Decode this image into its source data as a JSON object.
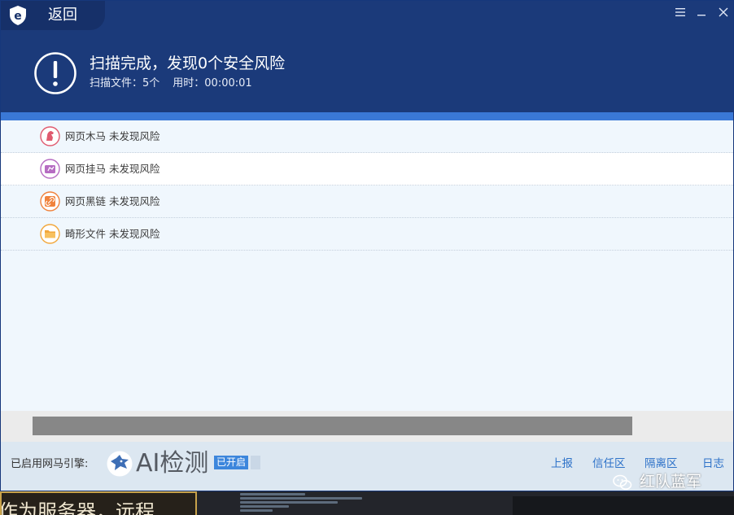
{
  "titlebar": {
    "back_label": "返回",
    "menu_icon": "menu-icon",
    "minimize_icon": "minimize-icon",
    "close_icon": "close-icon"
  },
  "scan_summary": {
    "title": "扫描完成，发现0个安全风险",
    "files_text": "扫描文件：5个",
    "time_text": "用时：00:00:01",
    "icon": "alert-exclamation-icon"
  },
  "results": [
    {
      "label": "网页木马 未发现风险",
      "icon": "webshell-horse-icon",
      "color": "#e05a6f",
      "selected": false
    },
    {
      "label": "网页挂马 未发现风险",
      "icon": "web-trojan-icon",
      "color": "#b66cc2",
      "selected": true
    },
    {
      "label": "网页黑链 未发现风险",
      "icon": "black-link-icon",
      "color": "#f0823c",
      "selected": false
    },
    {
      "label": "畸形文件 未发现风险",
      "icon": "folder-icon",
      "color": "#f2a73b",
      "selected": false
    }
  ],
  "footer": {
    "engine_label": "已启用网马引擎:",
    "ai_text": "AI检测",
    "enabled_badge": "已开启",
    "links": [
      "上报",
      "信任区",
      "隔离区",
      "日志"
    ]
  },
  "background": {
    "left_text": "作为服务器，远程"
  },
  "watermark": {
    "text": "红队蓝军"
  },
  "colors": {
    "header": "#1b3a7a",
    "accent": "#3a78d6",
    "link": "#2f73c9"
  }
}
